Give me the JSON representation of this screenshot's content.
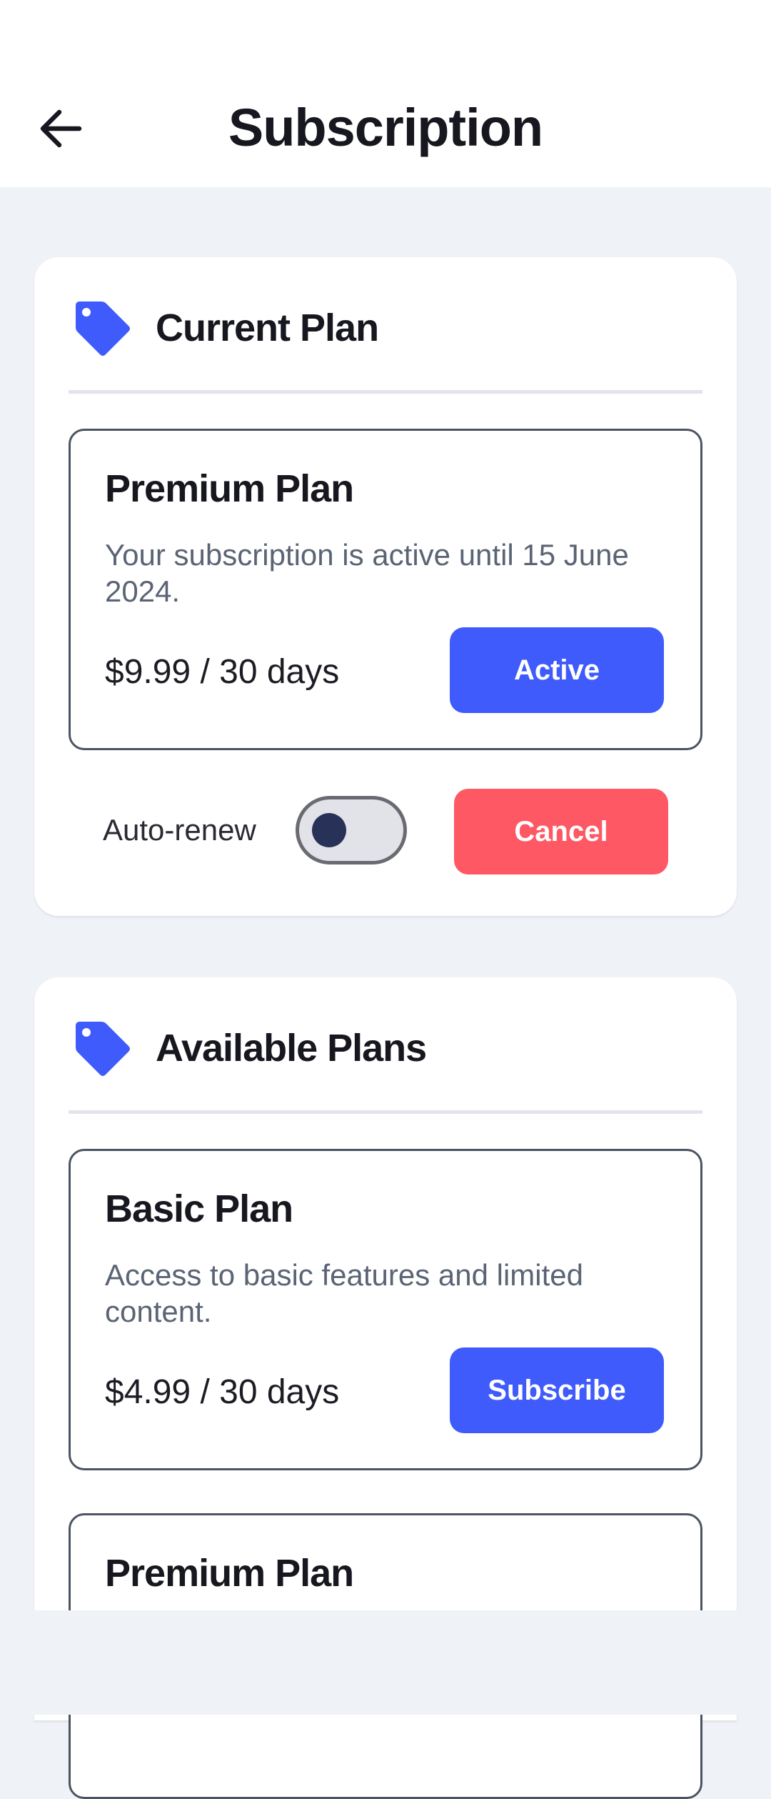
{
  "header": {
    "title": "Subscription",
    "back_icon": "arrow-left-icon"
  },
  "current_plan": {
    "section_title": "Current Plan",
    "icon": "tag-icon",
    "plan": {
      "name": "Premium Plan",
      "description": "Your subscription is active until 15 June 2024.",
      "price": "$9.99 / 30 days",
      "status_button": "Active"
    },
    "auto_renew": {
      "label": "Auto-renew",
      "enabled": false
    },
    "cancel_button": "Cancel"
  },
  "available_plans": {
    "section_title": "Available Plans",
    "icon": "tag-icon",
    "plans": [
      {
        "name": "Basic Plan",
        "description": "Access to basic features and limited content.",
        "price": "$4.99 / 30 days",
        "button": "Subscribe"
      },
      {
        "name": "Premium Plan"
      }
    ]
  },
  "colors": {
    "accent": "#3f5bfb",
    "danger": "#fd5863",
    "background": "#eff2f7"
  }
}
